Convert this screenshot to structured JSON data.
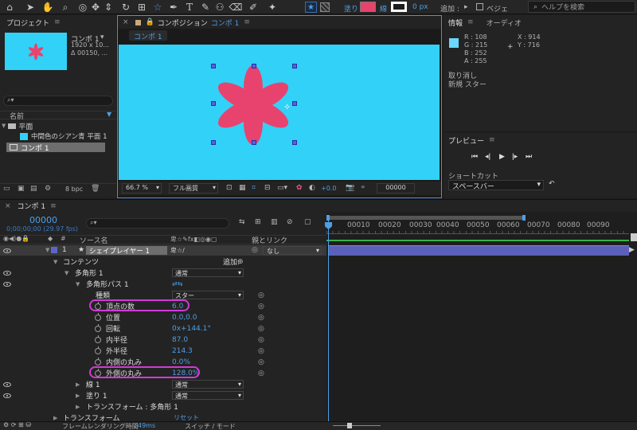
{
  "toolbar": {
    "fill_label": "塗り",
    "stroke_label": "線",
    "stroke_width": "0 px",
    "add_label": "追加 :",
    "bezier_label": "ベジェ",
    "search_placeholder": "ヘルプを検索",
    "fill_color": "#e8436e"
  },
  "project": {
    "title": "プロジェクト",
    "thumb_name": "コンポ 1",
    "thumb_info1": "1920 x 10...",
    "thumb_info2": "Δ 00150, ...",
    "col_name": "名前",
    "items": [
      "平面",
      "中間色のシアン青 平面 1",
      "コンポ 1"
    ],
    "bpc": "8 bpc"
  },
  "composition": {
    "title_prefix": "コンポジション",
    "title_name": "コンポ 1",
    "tab_label": "コンポ 1",
    "zoom": "66.7 %",
    "quality": "フル画質",
    "exposure": "+0.0",
    "timecode": "00000",
    "bg_color": "#32d1f7",
    "shape_color": "#e8436e"
  },
  "info": {
    "tab_info": "情報",
    "tab_audio": "オーディオ",
    "r": "R : 108",
    "g": "G : 215",
    "b": "B : 252",
    "a": "A : 255",
    "x": "X : 914",
    "y": "Y : 716",
    "undo": "取り消し",
    "new_star": "新規 スター"
  },
  "preview": {
    "title": "プレビュー",
    "shortcut_label": "ショートカット",
    "shortcut_value": "スペースバー"
  },
  "timeline": {
    "tab": "コンポ 1",
    "current_time": "00000",
    "fps": "0;00;00;00 (29.97 fps)",
    "col_source": "ソース名",
    "col_parent": "親とリンク",
    "ticks": [
      "00010",
      "00020",
      "00030",
      "00040",
      "00050",
      "00060",
      "00070",
      "00080",
      "00090"
    ],
    "layer_num": "1",
    "layer_name": "シェイプレイヤー 1",
    "parent_value": "なし",
    "contents": "コンテンツ",
    "add": "追加:",
    "polygon": "多角形 1",
    "normal": "通常",
    "path": "多角形パス 1",
    "type_label": "種類",
    "type_value": "スター",
    "props": [
      {
        "label": "頂点の数",
        "value": "6.0"
      },
      {
        "label": "位置",
        "value": "0.0,0.0"
      },
      {
        "label": "回転",
        "value": "0x+144.1°"
      },
      {
        "label": "内半径",
        "value": "87.0"
      },
      {
        "label": "外半径",
        "value": "214.3"
      },
      {
        "label": "内側の丸み",
        "value": "0.0%"
      },
      {
        "label": "外側の丸み",
        "value": "128.0%"
      }
    ],
    "stroke": "線 1",
    "fill": "塗り 1",
    "transform_poly": "トランスフォーム : 多角形 1",
    "transform": "トランスフォーム",
    "reset": "リセット",
    "render_label": "フレームレンダリング時間",
    "render_value": "49ms",
    "switch_mode": "スイッチ / モード"
  }
}
